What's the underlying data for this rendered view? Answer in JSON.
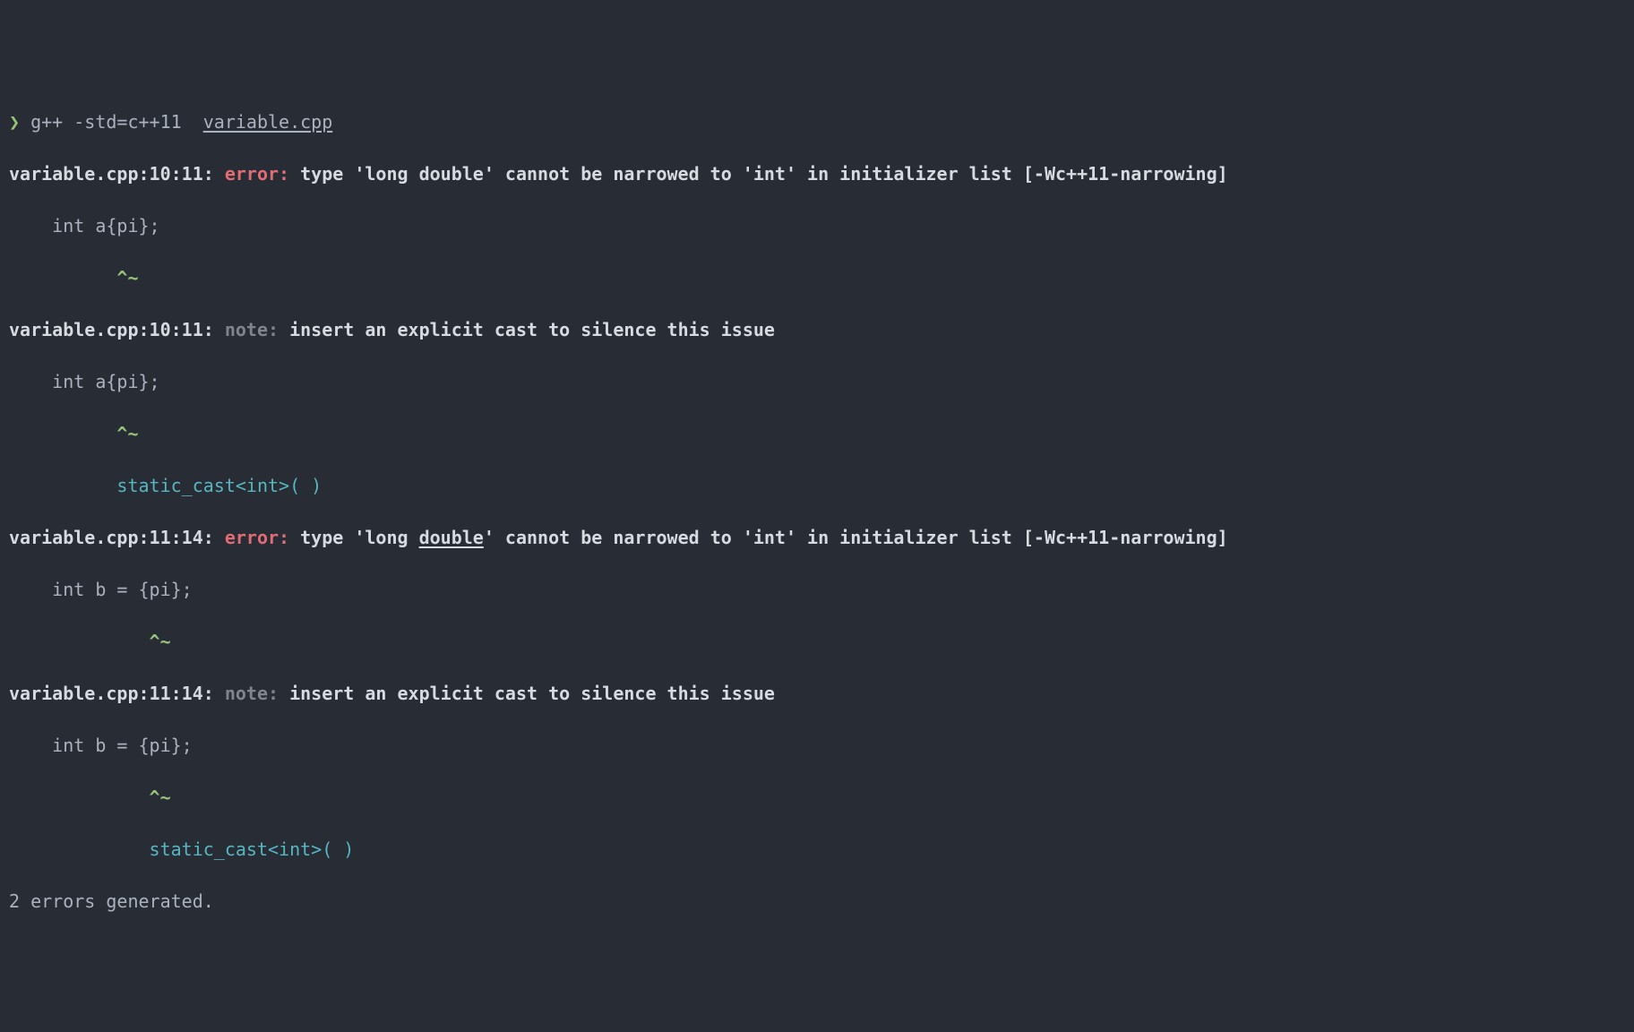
{
  "prompt": {
    "symbol": "❯",
    "command": "g++ -std=c++11  ",
    "argfile": "variable.cpp"
  },
  "diagnostics": [
    {
      "location": "variable.cpp:10:11:",
      "severity": "error",
      "severity_label": "error:",
      "message_pre": "type 'long double' cannot be narrowed to 'int' in initializer list ",
      "message_post": "",
      "warnflag": "[-Wc++11-narrowing]",
      "code_line": "    int a{pi};",
      "caret_line": "          ^~",
      "fixit_line": ""
    },
    {
      "location": "variable.cpp:10:11:",
      "severity": "note",
      "severity_label": "note:",
      "message_pre": "insert an explicit cast to silence this issue",
      "message_post": "",
      "warnflag": "",
      "code_line": "    int a{pi};",
      "caret_line": "          ^~",
      "fixit_line": "          static_cast<int>( )"
    },
    {
      "location": "variable.cpp:11:14:",
      "severity": "error",
      "severity_label": "error:",
      "message_pre": "type 'long ",
      "underlined": "double",
      "message_post": "' cannot be narrowed to 'int' in initializer list ",
      "warnflag": "[-Wc++11-narrowing]",
      "code_line": "    int b = {pi};",
      "caret_line": "             ^~",
      "fixit_line": ""
    },
    {
      "location": "variable.cpp:11:14:",
      "severity": "note",
      "severity_label": "note:",
      "message_pre": "insert an explicit cast to silence this issue",
      "message_post": "",
      "warnflag": "",
      "code_line": "    int b = {pi};",
      "caret_line": "             ^~",
      "fixit_line": "             static_cast<int>( )"
    }
  ],
  "summary": "2 errors generated."
}
